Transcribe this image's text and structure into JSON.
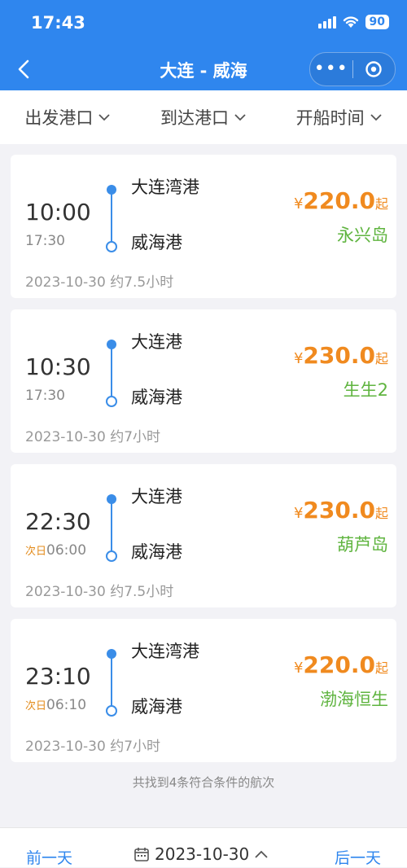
{
  "status": {
    "time": "17:43",
    "battery": "90"
  },
  "header": {
    "title": "大连 - 威海"
  },
  "filters": [
    {
      "label": "出发港口"
    },
    {
      "label": "到达港口"
    },
    {
      "label": "开船时间"
    }
  ],
  "trips": [
    {
      "depart_time": "10:00",
      "arrive_prefix": "",
      "arrive_time": "17:30",
      "from_port": "大连湾港",
      "to_port": "威海港",
      "currency": "¥",
      "price": "220.0",
      "price_suffix": "起",
      "ship": "永兴岛",
      "meta": "2023-10-30 约7.5小时"
    },
    {
      "depart_time": "10:30",
      "arrive_prefix": "",
      "arrive_time": "17:30",
      "from_port": "大连港",
      "to_port": "威海港",
      "currency": "¥",
      "price": "230.0",
      "price_suffix": "起",
      "ship": "生生2",
      "meta": "2023-10-30 约7小时"
    },
    {
      "depart_time": "22:30",
      "arrive_prefix": "次日",
      "arrive_time": "06:00",
      "from_port": "大连港",
      "to_port": "威海港",
      "currency": "¥",
      "price": "230.0",
      "price_suffix": "起",
      "ship": "葫芦岛",
      "meta": "2023-10-30 约7.5小时"
    },
    {
      "depart_time": "23:10",
      "arrive_prefix": "次日",
      "arrive_time": "06:10",
      "from_port": "大连湾港",
      "to_port": "威海港",
      "currency": "¥",
      "price": "220.0",
      "price_suffix": "起",
      "ship": "渤海恒生",
      "meta": "2023-10-30 约7小时"
    }
  ],
  "result_count": "共找到4条符合条件的航次",
  "bottom": {
    "prev": "前一天",
    "date": "2023-10-30",
    "next": "后一天"
  },
  "colors": {
    "accent": "#2f86ee",
    "price": "#f08a1f",
    "ship": "#5fb43f",
    "next_day": "#e38b1b"
  }
}
